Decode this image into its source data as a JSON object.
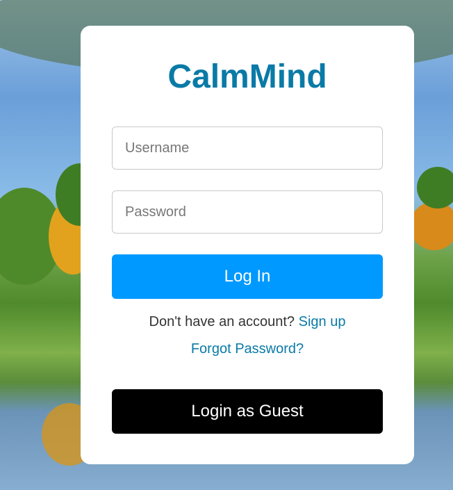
{
  "app": {
    "title": "CalmMind"
  },
  "form": {
    "username_placeholder": "Username",
    "username_value": "",
    "password_placeholder": "Password",
    "password_value": "",
    "login_label": "Log In",
    "signup_prompt": "Don't have an account?",
    "signup_link": "Sign up",
    "forgot_link": "Forgot Password?",
    "guest_label": "Login as Guest"
  },
  "colors": {
    "brand": "#0a7aa6",
    "login_button": "#0099ff",
    "guest_button": "#000000",
    "card": "#ffffff"
  }
}
